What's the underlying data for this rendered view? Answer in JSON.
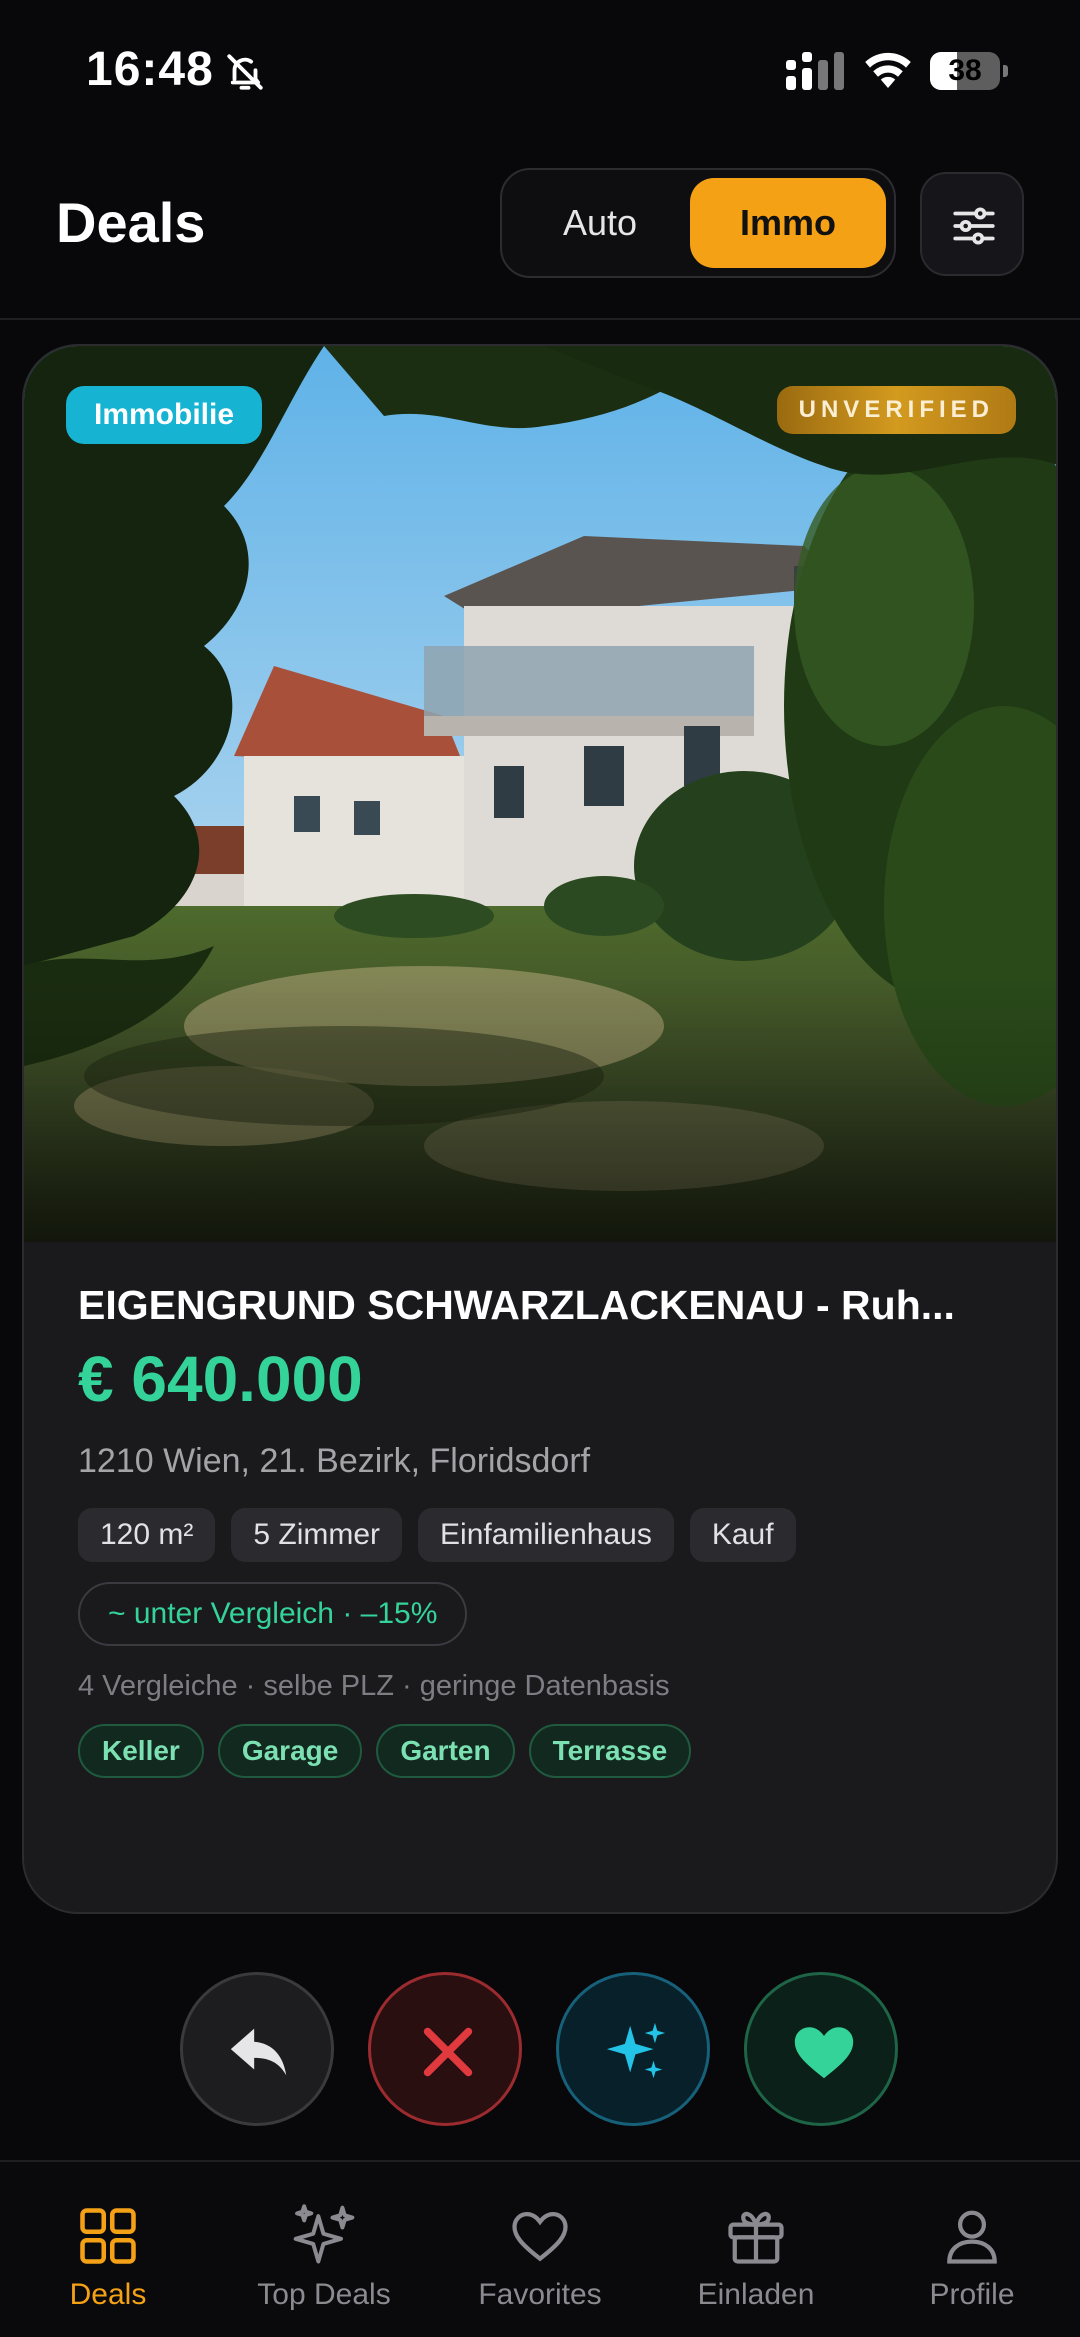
{
  "status_bar": {
    "time": "16:48",
    "battery_level": "38",
    "battery_fraction": 0.38
  },
  "header": {
    "title": "Deals",
    "segments": [
      "Auto",
      "Immo"
    ],
    "selected_segment": "Immo"
  },
  "listing": {
    "category_badge": "Immobilie",
    "verification_badge": "UNVERIFIED",
    "title": "EIGENGRUND SCHWARZLACKENAU - Ruh...",
    "price": "€ 640.000",
    "location": "1210 Wien, 21. Bezirk, Floridsdorf",
    "attributes": [
      "120 m²",
      "5 Zimmer",
      "Einfamilienhaus",
      "Kauf"
    ],
    "comparison": "~ unter Vergleich · –15%",
    "comparison_note": "4 Vergleiche · selbe PLZ · geringe Datenbasis",
    "features": [
      "Keller",
      "Garage",
      "Garten",
      "Terrasse"
    ]
  },
  "actions": [
    "undo-icon",
    "close-icon",
    "sparkles-icon",
    "heart-icon"
  ],
  "tabbar": {
    "active": "Deals",
    "items": [
      {
        "label": "Deals",
        "icon": "grid-icon"
      },
      {
        "label": "Top Deals",
        "icon": "sparkles-icon"
      },
      {
        "label": "Favorites",
        "icon": "heart-icon"
      },
      {
        "label": "Einladen",
        "icon": "gift-icon"
      },
      {
        "label": "Profile",
        "icon": "user-icon"
      }
    ]
  },
  "colors": {
    "accent": "#f5a116",
    "price_green": "#34d399",
    "badge_cyan": "#16b3d2",
    "reject_red": "#e0393e",
    "super_cyan": "#22c3e6"
  }
}
